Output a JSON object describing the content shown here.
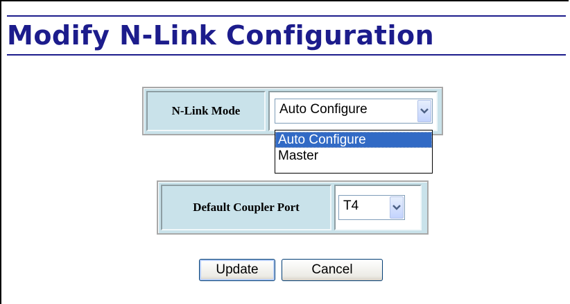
{
  "page": {
    "title": "Modify N-Link Configuration"
  },
  "form": {
    "nlink_mode": {
      "label": "N-Link Mode",
      "selected": "Auto Configure",
      "options": [
        "Auto Configure",
        "Master"
      ],
      "highlighted_option": "Auto Configure",
      "expanded": true
    },
    "default_coupler_port": {
      "label": "Default Coupler Port",
      "selected": "T4"
    }
  },
  "actions": {
    "update_label": "Update",
    "cancel_label": "Cancel"
  },
  "colors": {
    "title": "#1c1c8c",
    "table_bg": "#c9e2ea",
    "highlight": "#316ac5"
  },
  "icons": {
    "dropdown_arrow": "chevron-down-icon"
  }
}
